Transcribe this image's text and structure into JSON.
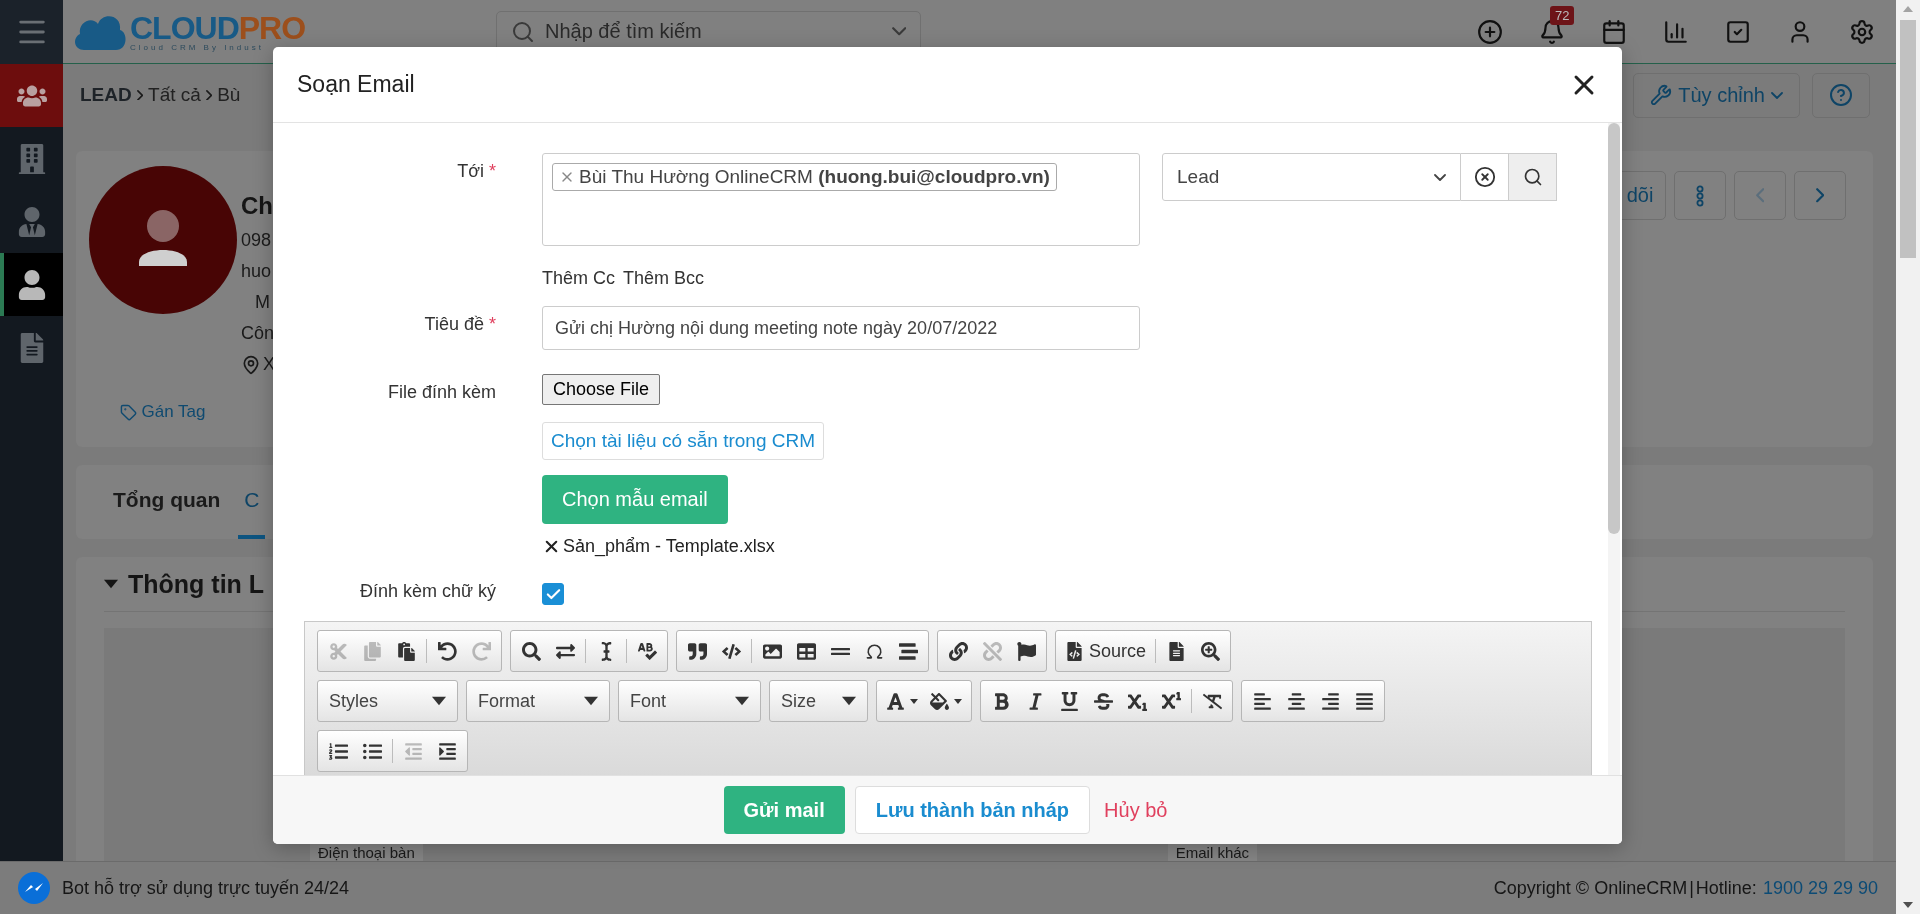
{
  "header": {
    "logo": {
      "word_1": "CLOUD",
      "word_2": "PRO",
      "tagline": "Cloud CRM By Indust"
    },
    "search": {
      "placeholder": "Nhập để tìm kiếm"
    },
    "notification_count": "72"
  },
  "sidebar": {
    "items": [
      {
        "selected": false,
        "highlighted": true
      },
      {
        "selected": false,
        "highlighted": false
      },
      {
        "selected": false,
        "highlighted": false
      },
      {
        "selected": true,
        "highlighted": false
      },
      {
        "selected": false,
        "highlighted": false
      }
    ]
  },
  "breadcrumb": [
    "LEAD",
    "Tất cả",
    "Bù"
  ],
  "page_actions": {
    "customize": "Tùy chỉnh"
  },
  "profile": {
    "name": "Ch",
    "lines": [
      "098",
      "huo",
      "M",
      "Côn"
    ],
    "address": "X",
    "tag_link": "Gán Tag",
    "follow": "dõi"
  },
  "tabs": [
    {
      "label": "Tổng quan",
      "selected": false
    },
    {
      "label": "C",
      "selected": true
    }
  ],
  "section": {
    "title": "Thông tin L",
    "fields": [
      "Điện thoại bàn",
      "Email khác"
    ]
  },
  "modal": {
    "title": "Soạn Email",
    "to": {
      "label": "Tới",
      "required_mark": "*",
      "recipients": [
        "Bùi Thu Hường OnlineCRM **(huong.bui@cloudpro.vn)**"
      ],
      "module": {
        "value": "Lead"
      }
    },
    "cc_links": [
      "Thêm Cc",
      "Thêm Bcc"
    ],
    "subject": {
      "label": "Tiêu đề",
      "required_mark": "*",
      "value": "Gửi chị Hường nội dung meeting note ngày 20/07/2022"
    },
    "attachments": {
      "label": "File đính kèm",
      "file_button": "Choose File",
      "crm_button": "Chọn tài liệu có sẵn trong CRM",
      "template_button": "Chọn mẫu email",
      "files": [
        {
          "name": "Sản_phẩm - Template.xlsx"
        }
      ]
    },
    "signature": {
      "label": "Đính kèm chữ ký",
      "checked": true
    },
    "editor": {
      "rows": [
        {
          "groups": [
            {
              "buttons": [
                {
                  "kind": "button",
                  "disabled": true
                },
                {
                  "kind": "button",
                  "disabled": true
                },
                {
                  "kind": "button",
                  "disabled": false
                },
                {
                  "kind": "separator"
                },
                {
                  "kind": "button",
                  "disabled": false
                },
                {
                  "kind": "button",
                  "disabled": true
                }
              ]
            },
            {
              "buttons": [
                {
                  "kind": "button",
                  "disabled": false
                },
                {
                  "kind": "button",
                  "disabled": false
                },
                {
                  "kind": "separator"
                },
                {
                  "kind": "button",
                  "disabled": false
                },
                {
                  "kind": "separator"
                },
                {
                  "kind": "button",
                  "disabled": false
                }
              ]
            },
            {
              "buttons": [
                {
                  "kind": "button",
                  "disabled": false
                },
                {
                  "kind": "button",
                  "disabled": false
                },
                {
                  "kind": "separator"
                },
                {
                  "kind": "button",
                  "disabled": false
                },
                {
                  "kind": "button",
                  "disabled": false
                },
                {
                  "kind": "button",
                  "disabled": false
                },
                {
                  "kind": "button",
                  "disabled": false
                },
                {
                  "kind": "button",
                  "disabled": false
                }
              ]
            },
            {
              "buttons": [
                {
                  "kind": "button",
                  "disabled": false
                },
                {
                  "kind": "button",
                  "disabled": true
                },
                {
                  "kind": "button",
                  "disabled": false
                }
              ]
            },
            {
              "buttons": [
                {
                  "kind": "button",
                  "disabled": false,
                  "label": "Source"
                },
                {
                  "kind": "separator"
                },
                {
                  "kind": "button",
                  "disabled": false
                },
                {
                  "kind": "button",
                  "disabled": false
                }
              ]
            }
          ]
        },
        {
          "groups": [
            {
              "buttons": [
                {
                  "kind": "combo",
                  "label": "Styles"
                }
              ]
            },
            {
              "buttons": [
                {
                  "kind": "combo",
                  "label": "Format"
                }
              ]
            },
            {
              "buttons": [
                {
                  "kind": "combo",
                  "label": "Font"
                }
              ]
            },
            {
              "buttons": [
                {
                  "kind": "combo",
                  "label": "Size"
                }
              ]
            },
            {
              "buttons": [
                {
                  "kind": "color",
                  "disabled": false
                },
                {
                  "kind": "color",
                  "disabled": false
                }
              ]
            },
            {
              "buttons": [
                {
                  "kind": "button",
                  "disabled": false
                },
                {
                  "kind": "button",
                  "disabled": false
                },
                {
                  "kind": "button",
                  "disabled": false
                },
                {
                  "kind": "button",
                  "disabled": false
                },
                {
                  "kind": "button",
                  "disabled": false
                },
                {
                  "kind": "button",
                  "disabled": false
                },
                {
                  "kind": "separator"
                },
                {
                  "kind": "button",
                  "disabled": false
                }
              ]
            },
            {
              "buttons": [
                {
                  "kind": "button",
                  "disabled": false
                },
                {
                  "kind": "button",
                  "disabled": false
                },
                {
                  "kind": "button",
                  "disabled": false
                },
                {
                  "kind": "button",
                  "disabled": false
                }
              ]
            }
          ]
        },
        {
          "groups": [
            {
              "buttons": [
                {
                  "kind": "button",
                  "disabled": false
                },
                {
                  "kind": "button",
                  "disabled": false
                },
                {
                  "kind": "separator"
                },
                {
                  "kind": "button",
                  "disabled": true
                },
                {
                  "kind": "button",
                  "disabled": false
                }
              ]
            }
          ]
        }
      ]
    },
    "actions": [
      {
        "label": "Gửi mail",
        "kind": "primary"
      },
      {
        "label": "Lưu thành bản nháp",
        "kind": "secondary"
      },
      {
        "label": "Hủy bỏ",
        "kind": "link"
      }
    ]
  },
  "bottom_bar": {
    "bot": "Bot hỗ trợ sử dụng trực tuyến 24/24",
    "copyright": "Copyright © OnlineCRM",
    "separator": "|",
    "hotline_label": "Hotline:",
    "hotline": "1900 29 29 90"
  }
}
